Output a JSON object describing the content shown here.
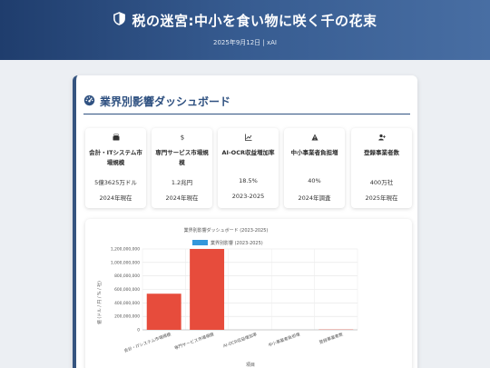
{
  "header": {
    "icon": "shield-half-icon",
    "title": "税の迷宮:中小を食い物に咲く千の花束",
    "meta": "2025年9月12日 | xAI"
  },
  "section": {
    "icon": "gauge-icon",
    "title": "業界別影響ダッシュボード"
  },
  "cards": [
    {
      "icon": "cash-register-icon",
      "title": "会計・ITシステム市場規模",
      "value": "5億3625万ドル",
      "date": "2024年現在"
    },
    {
      "icon": "dollar-icon",
      "title": "専門サービス市場規模",
      "value": "1.2兆円",
      "date": "2024年現在"
    },
    {
      "icon": "line-chart-icon",
      "title": "AI-OCR収益増加率",
      "value": "18.5%",
      "date": "2023-2025"
    },
    {
      "icon": "warning-icon",
      "title": "中小事業者負担増",
      "value": "40%",
      "date": "2024年調査"
    },
    {
      "icon": "user-plus-icon",
      "title": "登録事業者数",
      "value": "400万社",
      "date": "2025年現在"
    }
  ],
  "colors": {
    "header_start": "#1f3d6d",
    "header_end": "#486ea3",
    "accent": "#2f5181",
    "bar": "#e74c3c",
    "legend_swatch": "#3498db"
  },
  "chart_data": {
    "type": "bar",
    "title": "業界別影響ダッシュボード (2023-2025)",
    "xlabel": "項目",
    "ylabel": "値 (ドル / 円 / % / 社)",
    "categories": [
      "会計・ITシステム市場規模",
      "専門サービス市場規模",
      "AI-OCR収益増加率",
      "中小事業者負担増",
      "登録事業者数"
    ],
    "series": [
      {
        "name": "業界別影響 (2023-2025)",
        "values": [
          536250000,
          1200000000000,
          18.5,
          40,
          4000000
        ]
      }
    ],
    "ylim": [
      0,
      1200000000
    ],
    "yticks": [
      "0",
      "200,000,000",
      "400,000,000",
      "600,000,000",
      "800,000,000",
      "1,000,000,000",
      "1,200,000,000"
    ],
    "grid": true,
    "legend": "top"
  }
}
